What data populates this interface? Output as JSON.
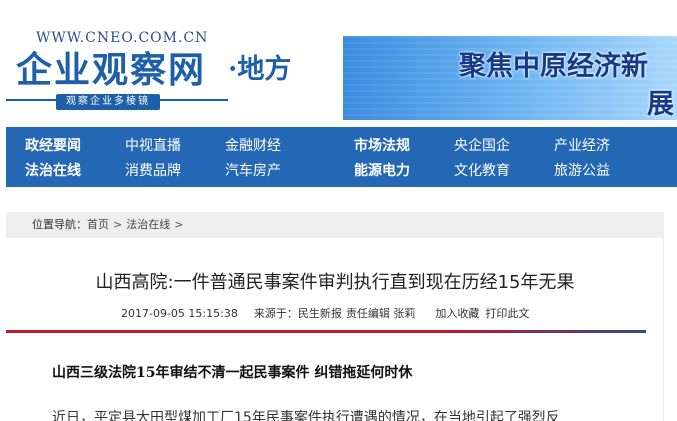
{
  "header": {
    "logo_url": "WWW.CNEO.COM.CN",
    "logo_name": "企业观察网",
    "logo_sub": "·地方",
    "logo_tagline": "观察企业多棱镜",
    "banner_line1": "聚焦中原经济新",
    "banner_line2": "展"
  },
  "nav": {
    "row1": [
      "政经要闻",
      "中视直播",
      "金融财经",
      "市场法规",
      "央企国企",
      "产业经济"
    ],
    "row2": [
      "法治在线",
      "消费品牌",
      "汽车房产",
      "能源电力",
      "文化教育",
      "旅游公益"
    ]
  },
  "breadcrumb": {
    "label": "位置导航：",
    "home": "首页",
    "sep": ">",
    "section": "法治在线",
    "trail_end": ">"
  },
  "article": {
    "title": "山西高院:一件普通民事案件审判执行直到现在历经15年无果",
    "date": "2017-09-05 15:15:38",
    "source": "来源于：民生新报",
    "editor": "责任编辑 张莉",
    "favorite": "加入收藏",
    "print": "打印此文",
    "subhead": "山西三级法院15年审结不清一起民事案件 纠错拖延何时休",
    "first_line": "近日，平定县大田型煤加工厂15年民事案件执行遭遇的情况，在当地引起了强烈反"
  },
  "colors": {
    "nav_bg": "#2467b4",
    "brand_blue": "#1d5fa8",
    "divider_red": "#c4172d"
  }
}
